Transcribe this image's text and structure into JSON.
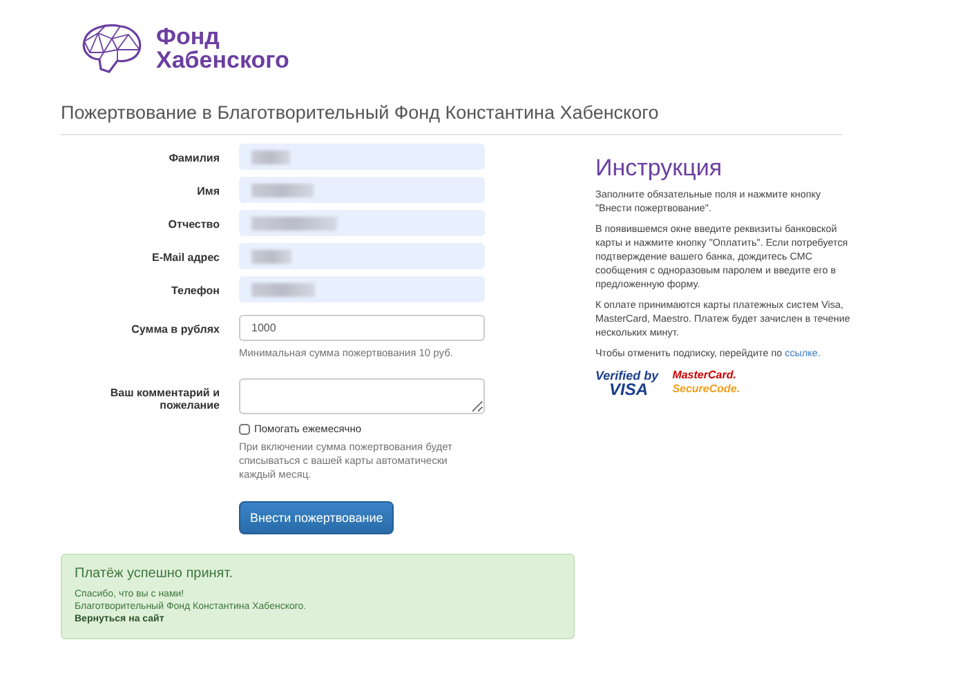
{
  "logo": {
    "line1": "Фонд",
    "line2": "Хабенского"
  },
  "page_title": "Пожертвование в Благотворительный Фонд Константина Хабенского",
  "form": {
    "fields": [
      {
        "kind": "blurred",
        "label": "Фамилия"
      },
      {
        "kind": "blurred",
        "label": "Имя"
      },
      {
        "kind": "blurred",
        "label": "Отчество"
      },
      {
        "kind": "blurred",
        "label": "E-Mail адрес"
      },
      {
        "kind": "blurred",
        "label": "Телефон"
      },
      {
        "kind": "input",
        "label": "Сумма в рублях",
        "value": "1000",
        "help": "Минимальная сумма пожертвования 10 руб."
      },
      {
        "kind": "textarea",
        "label": "Ваш комментарий и пожелание"
      }
    ],
    "monthly": {
      "label": "Помогать ежемесячно",
      "checked": false,
      "help": "При включении сумма пожертвования будет списываться с вашей карты автоматически каждый месяц."
    },
    "submit": "Внести пожертвование"
  },
  "alert": {
    "title": "Платёж успешно принят.",
    "lines": [
      "Спасибо, что вы с нами!",
      "Благотворительный Фонд Константина Хабенского."
    ],
    "link": "Вернуться на сайт"
  },
  "instruction": {
    "title": "Инструкция",
    "paragraphs": [
      "Заполните обязательные поля и нажмите кнопку \"Внести пожертвование\".",
      "В появившемся окне введите реквизиты банковской карты и нажмите кнопку \"Оплатить\". Если потребуется подтверждение вашего банка, дождитесь СМС сообщения с одноразовым паролем и введите его в предложенную форму.",
      "К оплате принимаются карты платежных систем Visa, MasterCard, Maestro. Платеж будет зачислен в течение нескольких минут."
    ],
    "cancel_text": "Чтобы отменить подписку, перейдите по",
    "cancel_link": "ссылке.",
    "badges": [
      {
        "kind": "visa",
        "line1": "Verified by",
        "line2": "VISA"
      },
      {
        "kind": "mastercard",
        "line1": "MasterCard.",
        "line2": "SecureCode."
      }
    ]
  }
}
